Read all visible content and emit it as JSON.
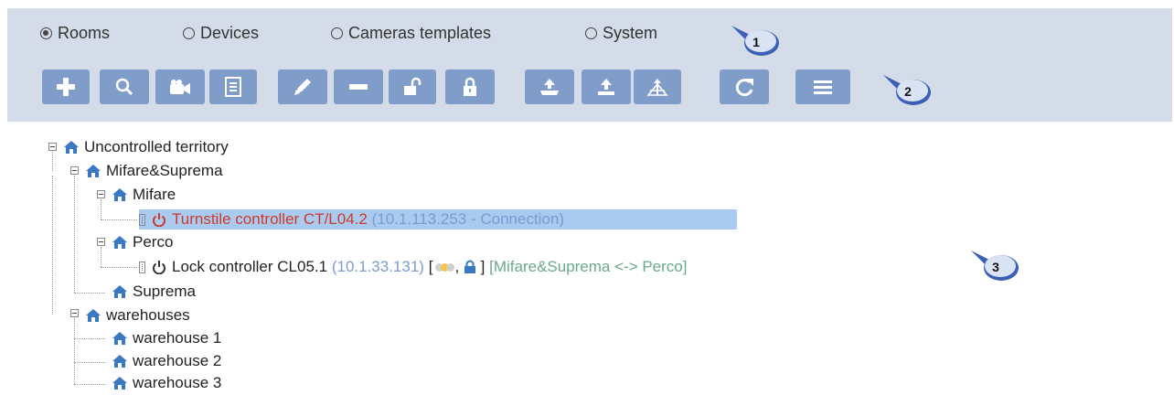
{
  "tabs": [
    {
      "label": "Rooms",
      "selected": true
    },
    {
      "label": "Devices",
      "selected": false
    },
    {
      "label": "Cameras templates",
      "selected": false
    },
    {
      "label": "System",
      "selected": false
    }
  ],
  "toolbar": {
    "buttons": [
      "add-icon",
      "search-icon",
      "camera-icon",
      "list-icon",
      "pencil-icon",
      "minus-icon",
      "unlock-icon",
      "lock-icon",
      "upload-tray-icon",
      "upload-icon",
      "tree-upload-icon",
      "refresh-icon",
      "menu-icon"
    ],
    "button_color": "#7f9dc8"
  },
  "callouts": [
    "1",
    "2",
    "3"
  ],
  "tree": {
    "root": "Uncontrolled territory",
    "mifare_suprema": "Mifare&Suprema",
    "mifare": "Mifare",
    "turnstile": {
      "name": "Turnstile controller CT/L04.2",
      "info": "(10.1.113.253 - Connection)"
    },
    "perco": "Perco",
    "lock": {
      "name": "Lock controller CL05.1",
      "ip": "(10.1.33.131)",
      "open": "[",
      "comma": ",",
      "close": "]",
      "zone": "[Mifare&Suprema <-> Perco]"
    },
    "suprema": "Suprema",
    "warehouses": "warehouses",
    "warehouse_items": [
      "warehouse 1",
      "warehouse 2",
      "warehouse 3"
    ]
  },
  "colors": {
    "topbar": "#d3dce8",
    "selection": "#aacbef",
    "error": "#cc3a2a",
    "ip": "#7b9bd0",
    "zone": "#6aa98a",
    "home": "#3a78c2"
  }
}
